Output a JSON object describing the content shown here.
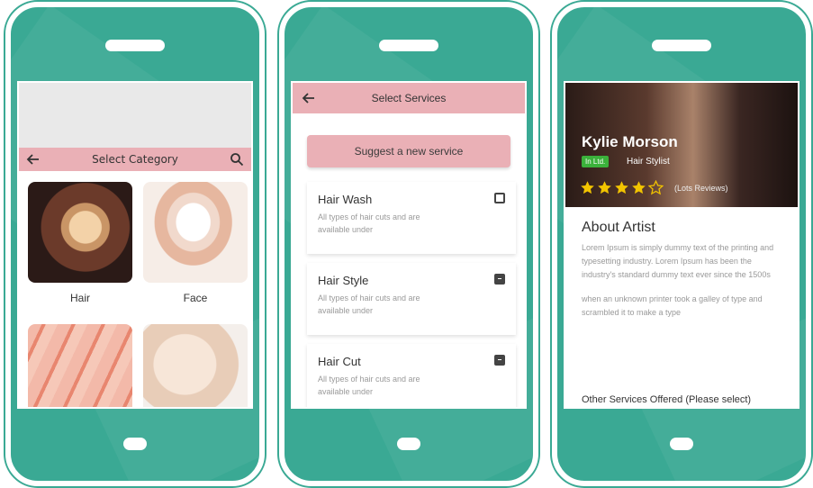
{
  "phone1": {
    "title": "Select Category",
    "categories": [
      {
        "label": "Hair"
      },
      {
        "label": "Face"
      },
      {
        "label": ""
      },
      {
        "label": ""
      }
    ]
  },
  "phone2": {
    "title": "Select Services",
    "suggest_label": "Suggest a new service",
    "services": [
      {
        "name": "Hair Wash",
        "desc": "All types of hair cuts and are available under",
        "checked": false
      },
      {
        "name": "Hair Style",
        "desc": "All types of hair cuts and are available under",
        "checked": true
      },
      {
        "name": "Hair Cut",
        "desc": "All types of hair cuts and are available under",
        "checked": true
      }
    ]
  },
  "phone3": {
    "name": "Kylie Morson",
    "badge": "In Ltd.",
    "role": "Hair Stylist",
    "rating": 4,
    "reviews": "(Lots Reviews)",
    "about_title": "About Artist",
    "about_p1": "Lorem Ipsum is simply dummy text of the printing and typesetting industry. Lorem Ipsum has been the industry's standard dummy text ever since the 1500s",
    "about_p2": "when an unknown printer took a galley of type and scrambled it to make a type",
    "other_services": "Other Services Offered (Please select)"
  },
  "colors": {
    "phone_green": "#3aa994",
    "accent_pink": "#eab0b6",
    "badge_green": "#3bb13b",
    "star_yellow": "#f2c400"
  }
}
